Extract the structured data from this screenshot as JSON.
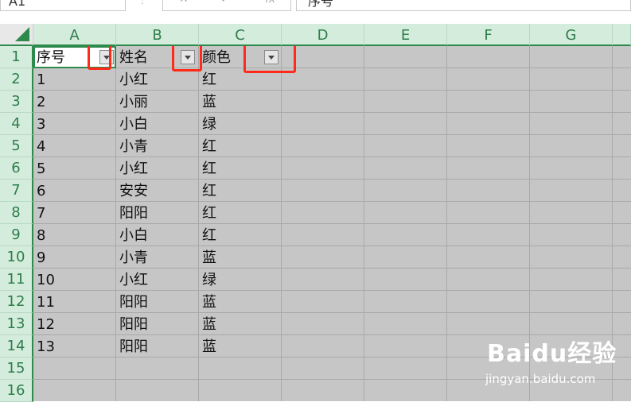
{
  "formula_bar": {
    "name_box": "A1",
    "formula": "序号"
  },
  "columns": [
    "A",
    "B",
    "C",
    "D",
    "E",
    "F",
    "G"
  ],
  "rows": [
    "1",
    "2",
    "3",
    "4",
    "5",
    "6",
    "7",
    "8",
    "9",
    "10",
    "11",
    "12",
    "13",
    "14",
    "15",
    "16"
  ],
  "header": {
    "col_a": "序号",
    "col_b": "姓名",
    "col_c": "颜色"
  },
  "data": [
    [
      "1",
      "小红",
      "红"
    ],
    [
      "2",
      "小丽",
      "蓝"
    ],
    [
      "3",
      "小白",
      "绿"
    ],
    [
      "4",
      "小青",
      "红"
    ],
    [
      "5",
      "小红",
      "红"
    ],
    [
      "6",
      "安安",
      "红"
    ],
    [
      "7",
      "阳阳",
      "红"
    ],
    [
      "8",
      "小白",
      "红"
    ],
    [
      "9",
      "小青",
      "蓝"
    ],
    [
      "10",
      "小红",
      "绿"
    ],
    [
      "11",
      "阳阳",
      "蓝"
    ],
    [
      "12",
      "阳阳",
      "蓝"
    ],
    [
      "13",
      "阳阳",
      "蓝"
    ]
  ],
  "watermark": {
    "brand": "Baidu经验",
    "site": "jingyan.baidu.com"
  },
  "colors": {
    "header_green": "#2e8a4c",
    "highlight": "#ff2a1a",
    "dimmed_sheet": "#c6c6c6"
  }
}
